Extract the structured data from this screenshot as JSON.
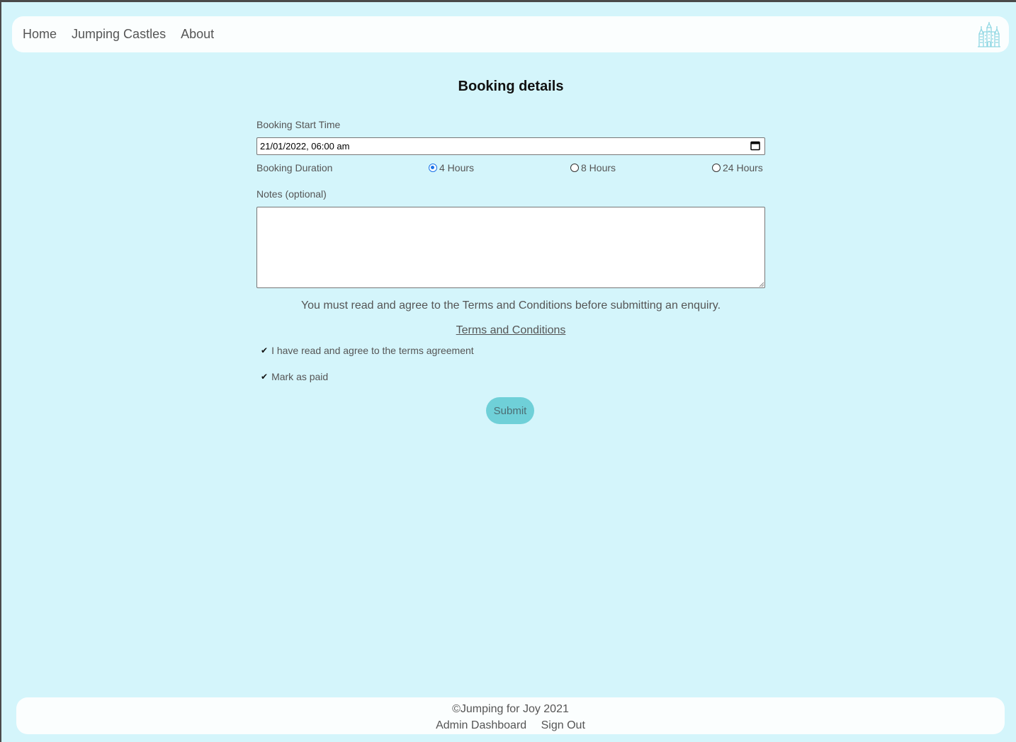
{
  "nav": {
    "links": [
      "Home",
      "Jumping Castles",
      "About"
    ],
    "logo_icon": "castle-icon",
    "logo_color": "#8fd7e3"
  },
  "form": {
    "title": "Booking details",
    "start_label": "Booking Start Time",
    "start_value": "21/01/2022, 06:00 am",
    "duration_label": "Booking Duration",
    "duration_options": [
      "4 Hours",
      "8 Hours",
      "24 Hours"
    ],
    "duration_selected": "4 Hours",
    "notes_label": "Notes (optional)",
    "notes_value": "",
    "terms_warning": "You must read and agree to the Terms and Conditions before submitting an enquiry.",
    "terms_link": "Terms and Conditions",
    "agree_label": "I have read and agree to the terms agreement",
    "agree_checked": true,
    "paid_label": "Mark as paid",
    "paid_checked": true,
    "submit_label": "Submit"
  },
  "footer": {
    "copyright": "©Jumping for Joy 2021",
    "links": [
      "Admin Dashboard",
      "Sign Out"
    ]
  },
  "colors": {
    "background": "#d4f5fb",
    "bar": "#fbfefe",
    "accent": "#6fd0d8",
    "radio_selected": "#1a73e8"
  }
}
